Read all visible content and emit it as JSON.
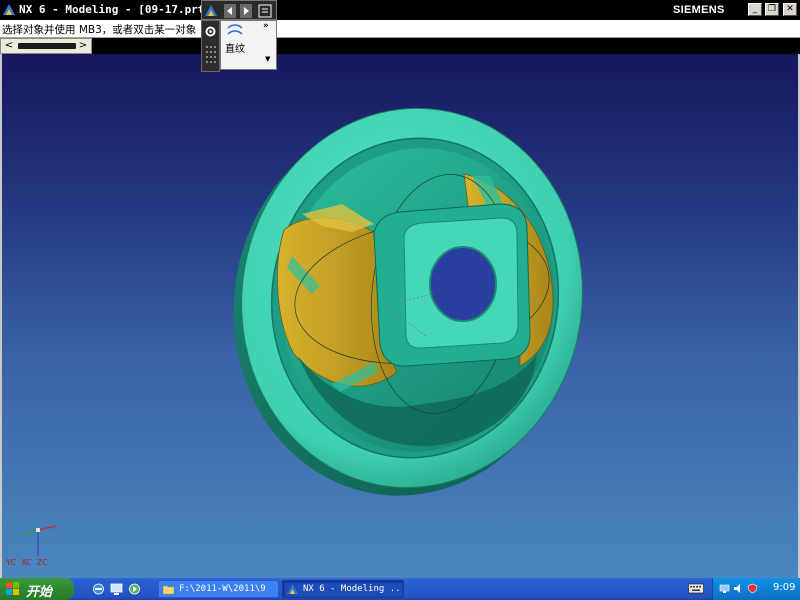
{
  "window": {
    "title": "NX 6 - Modeling - [09-17.prt]",
    "brand": "SIEMENS",
    "controls": {
      "minimize": "_",
      "restore": "❐",
      "close": "✕"
    }
  },
  "prompt": {
    "text": "选择对象并使用 MB3，或者双击某一对象"
  },
  "scroll": {
    "left_arrow": "<",
    "right_arrow": ">"
  },
  "popup": {
    "label": "直纹",
    "more": "»",
    "dropdown": "▼",
    "toolbar_icons": [
      "nx-logo-icon",
      "arrow-left-icon",
      "arrow-right-icon",
      "menu-icon",
      "gear-icon"
    ]
  },
  "viewport": {
    "wcs_label": "YC  XC  ZC",
    "colors": {
      "body": "#3fd0b0",
      "surface": "#c9a82a",
      "background_top": "#16165e",
      "background_bottom": "#4a86bf"
    }
  },
  "taskbar": {
    "start_label": "开始",
    "tasks": [
      {
        "label": "F:\\2011-W\\2011\\9",
        "icon": "folder-icon"
      },
      {
        "label": "NX 6 - Modeling ...",
        "icon": "nx-logo-icon"
      }
    ],
    "quick_launch": [
      "ie-icon",
      "desktop-icon",
      "media-icon"
    ],
    "tray_icons": [
      "network-icon",
      "volume-icon",
      "security-icon"
    ],
    "clock": "9:09"
  }
}
